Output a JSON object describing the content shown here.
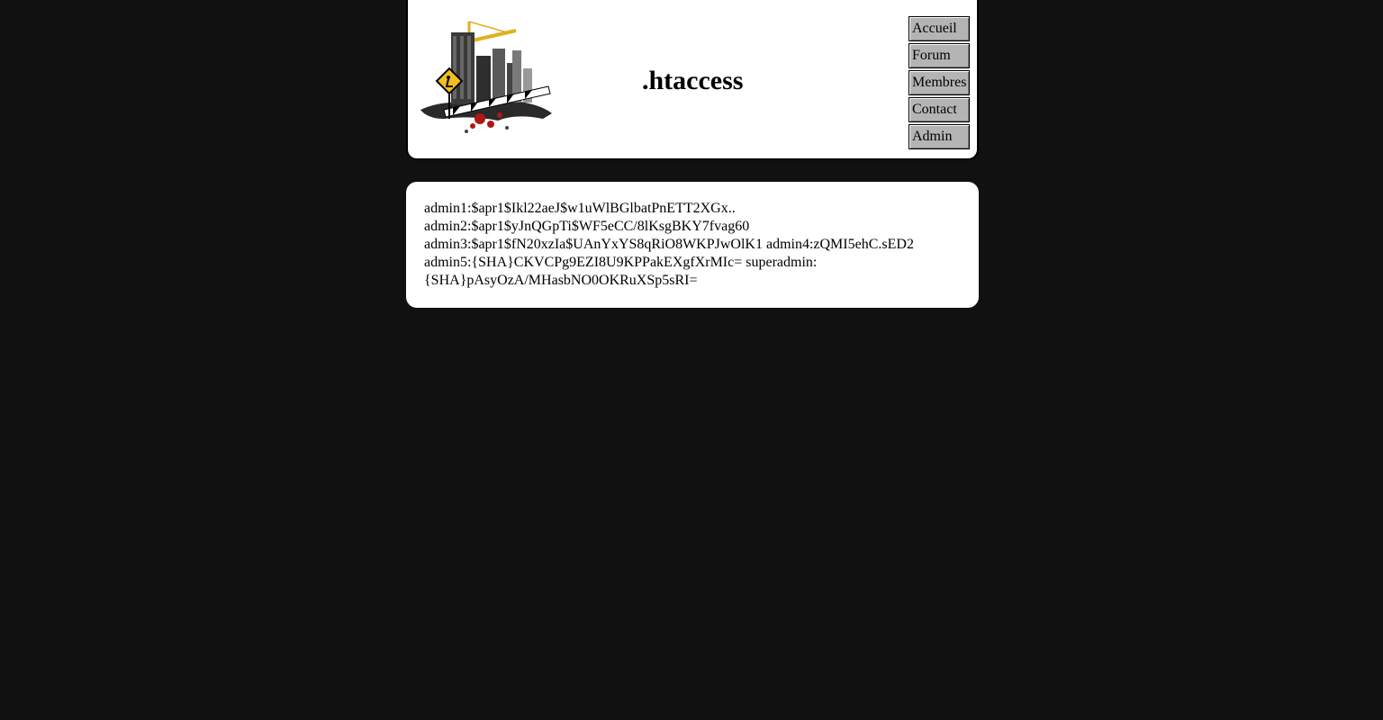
{
  "header": {
    "title": ".htaccess",
    "logo_name": "construction-city-logo"
  },
  "nav": {
    "items": [
      {
        "label": "Accueil"
      },
      {
        "label": "Forum"
      },
      {
        "label": "Membres"
      },
      {
        "label": "Contact"
      },
      {
        "label": "Admin"
      }
    ]
  },
  "content": {
    "lines": [
      "admin1:$apr1$Ikl22aeJ$w1uWlBGlbatPnETT2XGx..",
      "admin2:$apr1$yJnQGpTi$WF5eCC/8lKsgBKY7fvag60",
      "admin3:$apr1$fN20xzIa$UAnYxYS8qRiO8WKPJwOlK1 admin4:zQMI5ehC.sED2",
      "admin5:{SHA}CKVCPg9EZI8U9KPPakEXgfXrMIc= superadmin:",
      "{SHA}pAsyOzA/MHasbNO0OKRuXSp5sRI="
    ]
  },
  "colors": {
    "background": "#111111",
    "panel": "#ffffff",
    "nav_button": "#b4b4b4",
    "logo_yellow": "#f0c020",
    "logo_red": "#b01818"
  }
}
